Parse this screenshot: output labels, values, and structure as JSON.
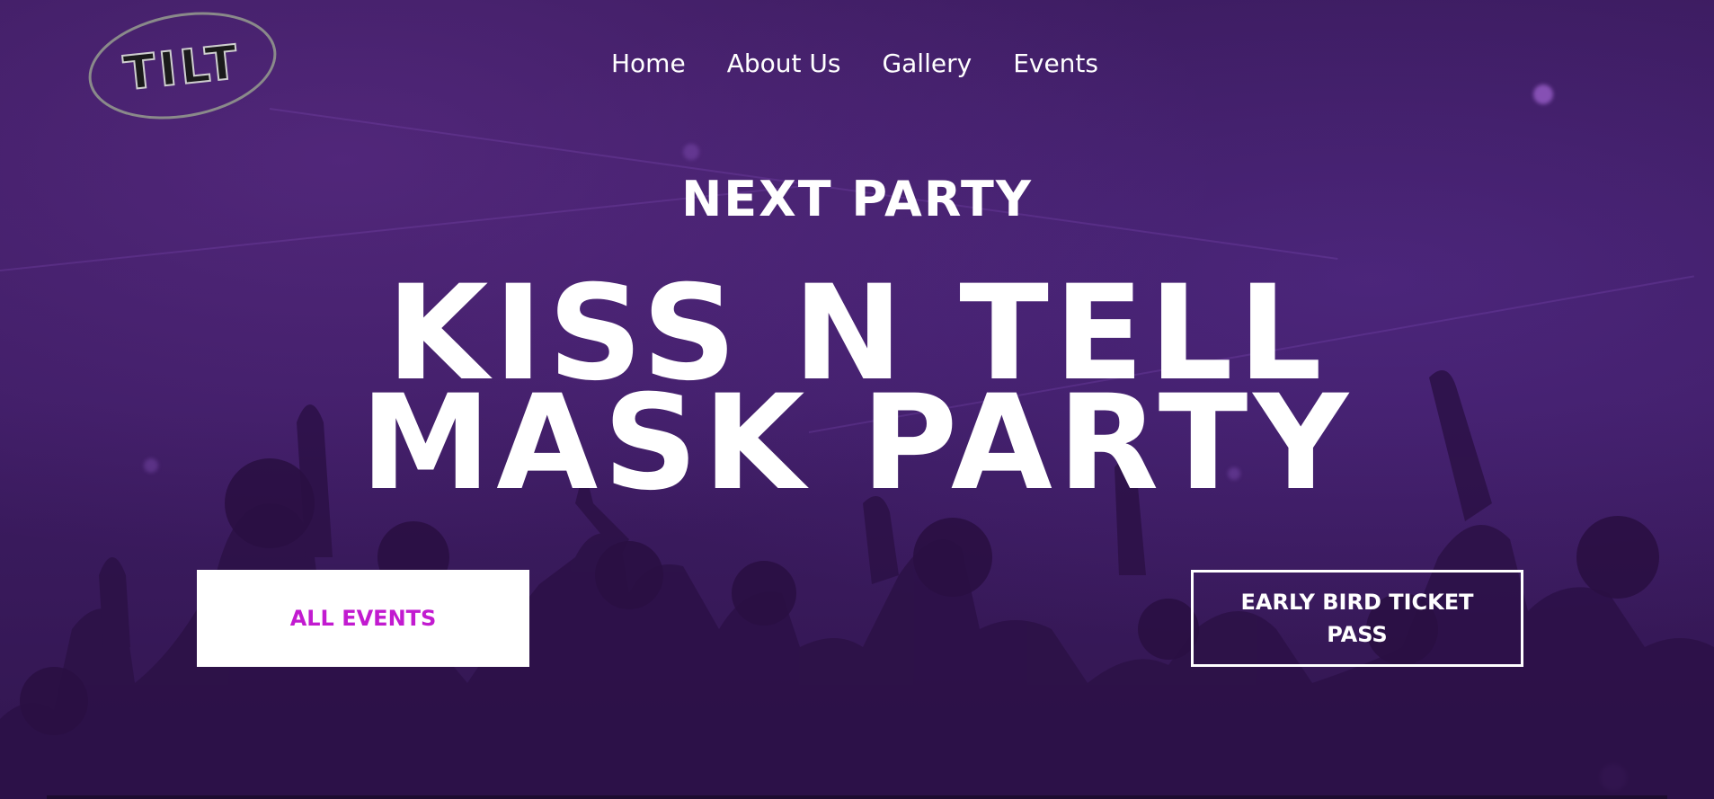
{
  "brand": {
    "logo_text": "TILT"
  },
  "nav": {
    "items": [
      {
        "label": "Home"
      },
      {
        "label": "About Us"
      },
      {
        "label": "Gallery"
      },
      {
        "label": "Events"
      }
    ]
  },
  "hero": {
    "eyebrow": "NEXT PARTY",
    "headline": "KISS N TELL MASK PARTY",
    "primary_button": "ALL EVENTS",
    "secondary_button": "EARLY BIRD TICKET PASS"
  },
  "colors": {
    "background": "#3a1a5c",
    "accent": "#c21bd0",
    "text": "#ffffff"
  }
}
